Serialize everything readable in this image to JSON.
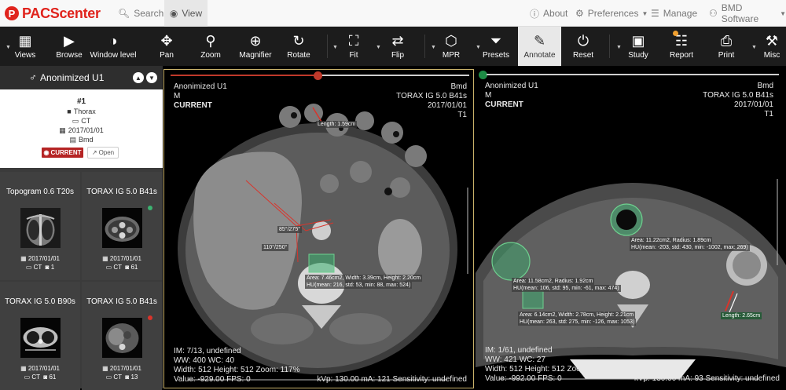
{
  "navbar": {
    "brand": "PACScenter",
    "brand_logo": "P",
    "search": "Search",
    "view": "View",
    "about": "About",
    "preferences": "Preferences",
    "manage": "Manage",
    "user": "BMD Software"
  },
  "toolbar": {
    "views": "Views",
    "browse": "Browse",
    "window_level": "Window level",
    "pan": "Pan",
    "zoom": "Zoom",
    "magnifier": "Magnifier",
    "rotate": "Rotate",
    "fit": "Fit",
    "flip": "Flip",
    "mpr": "MPR",
    "presets": "Presets",
    "annotate": "Annotate",
    "reset": "Reset",
    "study": "Study",
    "report": "Report",
    "print": "Print",
    "misc": "Misc"
  },
  "sidebar": {
    "patient_name": "Anonimized U1",
    "study": {
      "number": "#1",
      "body_part": "Thorax",
      "modality": "CT",
      "date": "2017/01/01",
      "institution": "Bmd",
      "current_label": "CURRENT",
      "open_label": "Open"
    },
    "series": [
      {
        "title": "Topogram 0.6 T20s",
        "date": "2017/01/01",
        "modality": "CT",
        "count": "1",
        "status": ""
      },
      {
        "title": "TORAX IG 5.0 B41s",
        "date": "2017/01/01",
        "modality": "CT",
        "count": "61",
        "status": "#3cb371"
      },
      {
        "title": "TORAX IG 5.0 B90s",
        "date": "2017/01/01",
        "modality": "CT",
        "count": "61",
        "status": ""
      },
      {
        "title": "TORAX IG 5.0 B41s",
        "date": "2017/01/01",
        "modality": "CT",
        "count": "13",
        "status": "#d9342b"
      }
    ]
  },
  "viewports": {
    "left": {
      "patient": "Anonimized U1",
      "sex": "M",
      "tag": "CURRENT",
      "institution": "Bmd",
      "series": "TORAX IG  5.0  B41s",
      "date": "2017/01/01",
      "im": "IM: 7/13, undefined",
      "ww": "WW: 400  WC: 40",
      "size": "Width: 512  Height: 512  Zoom: 117%",
      "value": "Value: -929.00  FPS: 0",
      "kvp": "kVp: 130.00  mA: 121  Sensitivity: undefined",
      "measurements": {
        "length": "Length: 1.59cm",
        "angle1": "85°/275°",
        "angle2": "110°/250°",
        "area": "Area: 7.46cm2, Width: 3.39cm, Height: 2.20cm",
        "hu": "HU(mean: 216, std: 53, min: 88, max: 524)"
      },
      "slider_color": "#c0392b"
    },
    "right": {
      "patient": "Anonimized U1",
      "sex": "M",
      "tag": "CURRENT",
      "institution": "Bmd",
      "series": "TORAX IG  5.0  B41s",
      "date": "2017/01/01",
      "slice": "T1",
      "im": "IM: 1/61, undefined",
      "ww": "WW: 421  WC: 27",
      "size": "Width: 512  Height: 512  Zoom: 11%",
      "value": "Value: -992.00  FPS: 0",
      "kvp": "kVp: 130.00  mA: 93  Sensitivity: undefined",
      "measurements": {
        "area1": "Area: 11.22cm2, Radius: 1.89cm",
        "hu1": "HU(mean: -203, std: 430, min: -1002, max: 269)",
        "area2": "Area: 11.58cm2, Radius: 1.92cm",
        "hu2": "HU(mean: 106, std: 95, min: -61, max: 474)",
        "area3": "Area: 6.14cm2, Width: 2.78cm, Height: 2.21cm",
        "hu3": "HU(mean: 263, std: 275, min: -126, max: 1053)",
        "length": "Length: 2.65cm"
      },
      "slider_color": "#1e8c46"
    },
    "left_slice": "T1"
  },
  "colors": {
    "brand": "#e0231c",
    "toolbar_bg": "#1c1c1c",
    "annotation_red": "#d9342b",
    "roi_green": "#3cb371",
    "active_border": "#c9b26a"
  }
}
